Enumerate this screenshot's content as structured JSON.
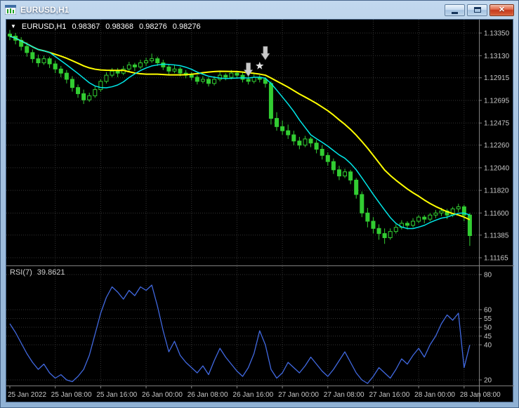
{
  "window": {
    "title": "EURUSD,H1",
    "controls": {
      "close_glyph": "✕"
    }
  },
  "chart": {
    "header": {
      "collapse_icon": "▼",
      "symbol": "EURUSD,H1",
      "open": "0.98367",
      "high": "0.98368",
      "low": "0.98276",
      "close": "0.98276"
    },
    "rsi_label": {
      "name": "RSI(7)",
      "value": "39.8621"
    }
  },
  "chart_data": {
    "type": "candlestick",
    "title": "EURUSD,H1",
    "x_axis": {
      "labels": [
        "25 Jan 2022",
        "25 Jan 08:00",
        "25 Jan 16:00",
        "26 Jan 00:00",
        "26 Jan 08:00",
        "26 Jan 16:00",
        "27 Jan 00:00",
        "27 Jan 08:00",
        "27 Jan 16:00",
        "28 Jan 00:00",
        "28 Jan 08:00"
      ],
      "bars_per_label": 8
    },
    "y_axis": {
      "labels": [
        "1.13350",
        "1.13130",
        "1.12915",
        "1.12695",
        "1.12475",
        "1.12260",
        "1.12040",
        "1.11820",
        "1.11600",
        "1.11385",
        "1.11165"
      ],
      "min": 1.1109,
      "max": 1.1348
    },
    "candles_ohlc": [
      [
        1.1334,
        1.1338,
        1.1328,
        1.1332
      ],
      [
        1.1332,
        1.1335,
        1.1324,
        1.1328
      ],
      [
        1.1328,
        1.1331,
        1.1318,
        1.1322
      ],
      [
        1.1322,
        1.1326,
        1.1312,
        1.1316
      ],
      [
        1.1316,
        1.1319,
        1.1306,
        1.131
      ],
      [
        1.131,
        1.1314,
        1.1302,
        1.1306
      ],
      [
        1.1306,
        1.1313,
        1.1304,
        1.131
      ],
      [
        1.131,
        1.1312,
        1.1301,
        1.1305
      ],
      [
        1.1305,
        1.1308,
        1.1296,
        1.13
      ],
      [
        1.13,
        1.1303,
        1.1292,
        1.1296
      ],
      [
        1.1296,
        1.1299,
        1.1286,
        1.129
      ],
      [
        1.129,
        1.1293,
        1.1278,
        1.1282
      ],
      [
        1.1282,
        1.1285,
        1.1272,
        1.1276
      ],
      [
        1.1276,
        1.128,
        1.1266,
        1.127
      ],
      [
        1.127,
        1.1277,
        1.1268,
        1.1274
      ],
      [
        1.1274,
        1.1283,
        1.1272,
        1.128
      ],
      [
        1.128,
        1.129,
        1.1278,
        1.1288
      ],
      [
        1.1288,
        1.1297,
        1.1286,
        1.1294
      ],
      [
        1.1294,
        1.1301,
        1.1292,
        1.1298
      ],
      [
        1.1298,
        1.1301,
        1.1292,
        1.1296
      ],
      [
        1.1296,
        1.1303,
        1.1294,
        1.13
      ],
      [
        1.13,
        1.1307,
        1.1298,
        1.1304
      ],
      [
        1.1304,
        1.1306,
        1.1298,
        1.1302
      ],
      [
        1.1302,
        1.1309,
        1.13,
        1.1306
      ],
      [
        1.1306,
        1.1311,
        1.1303,
        1.1308
      ],
      [
        1.1308,
        1.1315,
        1.1306,
        1.131
      ],
      [
        1.131,
        1.1312,
        1.1303,
        1.1306
      ],
      [
        1.1306,
        1.1309,
        1.1299,
        1.1302
      ],
      [
        1.1302,
        1.1305,
        1.1295,
        1.1298
      ],
      [
        1.1298,
        1.1304,
        1.1296,
        1.13
      ],
      [
        1.13,
        1.1302,
        1.1293,
        1.1296
      ],
      [
        1.1296,
        1.1299,
        1.1291,
        1.1294
      ],
      [
        1.1294,
        1.1297,
        1.1289,
        1.1292
      ],
      [
        1.1292,
        1.1294,
        1.1285,
        1.1288
      ],
      [
        1.1288,
        1.1293,
        1.1286,
        1.129
      ],
      [
        1.129,
        1.1292,
        1.1283,
        1.1286
      ],
      [
        1.1286,
        1.1293,
        1.1284,
        1.129
      ],
      [
        1.129,
        1.1297,
        1.1288,
        1.1294
      ],
      [
        1.1294,
        1.1296,
        1.1289,
        1.1292
      ],
      [
        1.1292,
        1.1299,
        1.129,
        1.1296
      ],
      [
        1.1296,
        1.1298,
        1.1291,
        1.1294
      ],
      [
        1.1294,
        1.1297,
        1.1287,
        1.129
      ],
      [
        1.129,
        1.1293,
        1.1285,
        1.1288
      ],
      [
        1.1288,
        1.1295,
        1.1286,
        1.1292
      ],
      [
        1.1292,
        1.1294,
        1.1287,
        1.129
      ],
      [
        1.129,
        1.1292,
        1.1282,
        1.1286
      ],
      [
        1.1286,
        1.1288,
        1.1246,
        1.1252
      ],
      [
        1.1252,
        1.1258,
        1.124,
        1.1244
      ],
      [
        1.1244,
        1.125,
        1.1236,
        1.124
      ],
      [
        1.124,
        1.1246,
        1.1232,
        1.1236
      ],
      [
        1.1236,
        1.124,
        1.1226,
        1.123
      ],
      [
        1.123,
        1.1234,
        1.1222,
        1.1226
      ],
      [
        1.1226,
        1.1235,
        1.1224,
        1.1232
      ],
      [
        1.1232,
        1.1234,
        1.1224,
        1.1228
      ],
      [
        1.1228,
        1.1231,
        1.1218,
        1.1222
      ],
      [
        1.1222,
        1.1226,
        1.1212,
        1.1216
      ],
      [
        1.1216,
        1.1219,
        1.1206,
        1.121
      ],
      [
        1.121,
        1.1213,
        1.1198,
        1.1202
      ],
      [
        1.1202,
        1.1206,
        1.1192,
        1.1196
      ],
      [
        1.1196,
        1.1203,
        1.1194,
        1.12
      ],
      [
        1.12,
        1.1202,
        1.1188,
        1.1192
      ],
      [
        1.1192,
        1.1194,
        1.1174,
        1.1178
      ],
      [
        1.1178,
        1.1181,
        1.1156,
        1.116
      ],
      [
        1.116,
        1.1165,
        1.1146,
        1.1152
      ],
      [
        1.1152,
        1.1156,
        1.114,
        1.1145
      ],
      [
        1.1145,
        1.1149,
        1.1134,
        1.114
      ],
      [
        1.114,
        1.1145,
        1.113,
        1.1136
      ],
      [
        1.1136,
        1.1145,
        1.1134,
        1.1142
      ],
      [
        1.1142,
        1.1149,
        1.114,
        1.1146
      ],
      [
        1.1146,
        1.1153,
        1.1144,
        1.115
      ],
      [
        1.115,
        1.1152,
        1.1144,
        1.1148
      ],
      [
        1.1148,
        1.1155,
        1.1146,
        1.1152
      ],
      [
        1.1152,
        1.1158,
        1.115,
        1.1156
      ],
      [
        1.1156,
        1.1158,
        1.115,
        1.1154
      ],
      [
        1.1154,
        1.116,
        1.1152,
        1.1158
      ],
      [
        1.1158,
        1.1163,
        1.1155,
        1.116
      ],
      [
        1.116,
        1.1165,
        1.1157,
        1.1162
      ],
      [
        1.1162,
        1.1164,
        1.1154,
        1.1158
      ],
      [
        1.1158,
        1.1166,
        1.1156,
        1.1164
      ],
      [
        1.1164,
        1.1169,
        1.1161,
        1.1166
      ],
      [
        1.1166,
        1.1168,
        1.1152,
        1.1158
      ],
      [
        1.1158,
        1.116,
        1.1128,
        1.1138
      ]
    ],
    "overlays": [
      {
        "name": "ma-slow",
        "type": "sma",
        "period": 21,
        "color": "#FFFF00",
        "width": 2
      },
      {
        "name": "ma-fast",
        "type": "sma",
        "period": 8,
        "color": "#00E8E8",
        "width": 1.5
      }
    ],
    "rsi_pane": {
      "label": "RSI(7)",
      "current": 39.8621,
      "values": [
        52,
        47,
        41,
        35,
        30,
        26,
        29,
        24,
        21,
        23,
        20,
        19,
        22,
        26,
        34,
        46,
        58,
        67,
        73,
        70,
        66,
        71,
        68,
        73,
        71,
        74,
        62,
        48,
        36,
        42,
        34,
        30,
        27,
        24,
        28,
        23,
        31,
        38,
        33,
        29,
        25,
        22,
        27,
        35,
        48,
        40,
        26,
        21,
        24,
        30,
        27,
        24,
        28,
        33,
        29,
        25,
        22,
        26,
        31,
        36,
        30,
        24,
        20,
        18,
        22,
        27,
        24,
        21,
        26,
        32,
        29,
        34,
        38,
        33,
        40,
        45,
        52,
        57,
        54,
        58,
        27,
        39.8621
      ],
      "levels": [
        80,
        60,
        55,
        50,
        45,
        40,
        20
      ],
      "range": [
        16.8,
        84.8
      ],
      "color": "#4169E1"
    },
    "markers": [
      {
        "type": "arrow-down",
        "bar": 42,
        "price": 1.1293
      },
      {
        "type": "arrow-down",
        "bar": 45,
        "price": 1.1309
      },
      {
        "type": "star",
        "bar": 44,
        "price": 1.1303
      }
    ],
    "colors": {
      "background": "#000000",
      "grid": "#343434",
      "candle": "#32CD32",
      "axis_text": "#C8C8C8",
      "separator": "#808080",
      "marker": "#C9C9C9"
    }
  }
}
